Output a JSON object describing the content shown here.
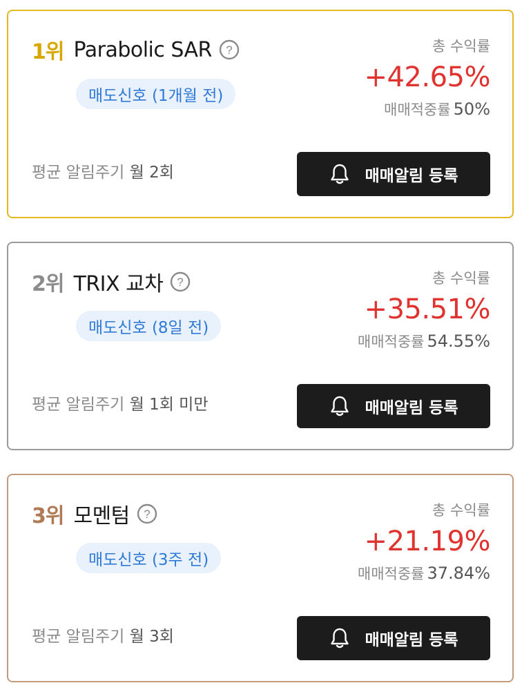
{
  "cards": [
    {
      "rank": "1위",
      "rank_color": "#d9a800",
      "border_color": "#e3b820",
      "name": "Parabolic SAR",
      "signal": "매도신호 (1개월 전)",
      "total_return_label": "총 수익률",
      "total_return": "+42.65%",
      "accuracy_label": "매매적중률",
      "accuracy": "50%",
      "alert_cycle_label": "평균 알림주기",
      "alert_cycle": "월 2회",
      "button_label": "매매알림 등록"
    },
    {
      "rank": "2위",
      "rank_color": "#8c8c8c",
      "border_color": "#9a9a9a",
      "name": "TRIX 교차",
      "signal": "매도신호 (8일 전)",
      "total_return_label": "총 수익률",
      "total_return": "+35.51%",
      "accuracy_label": "매매적중률",
      "accuracy": "54.55%",
      "alert_cycle_label": "평균 알림주기",
      "alert_cycle": "월 1회 미만",
      "button_label": "매매알림 등록"
    },
    {
      "rank": "3위",
      "rank_color": "#b07a56",
      "border_color": "#c49a7c",
      "name": "모멘텀",
      "signal": "매도신호 (3주 전)",
      "total_return_label": "총 수익률",
      "total_return": "+21.19%",
      "accuracy_label": "매매적중률",
      "accuracy": "37.84%",
      "alert_cycle_label": "평균 알림주기",
      "alert_cycle": "월 3회",
      "button_label": "매매알림 등록"
    }
  ],
  "icons": {
    "help": "help-icon",
    "bell": "bell-icon"
  },
  "colors": {
    "return_red": "#e0322e",
    "signal_blue": "#2f7ad8",
    "signal_bg": "#e8f1fc",
    "button_bg": "#1c1c1c"
  }
}
